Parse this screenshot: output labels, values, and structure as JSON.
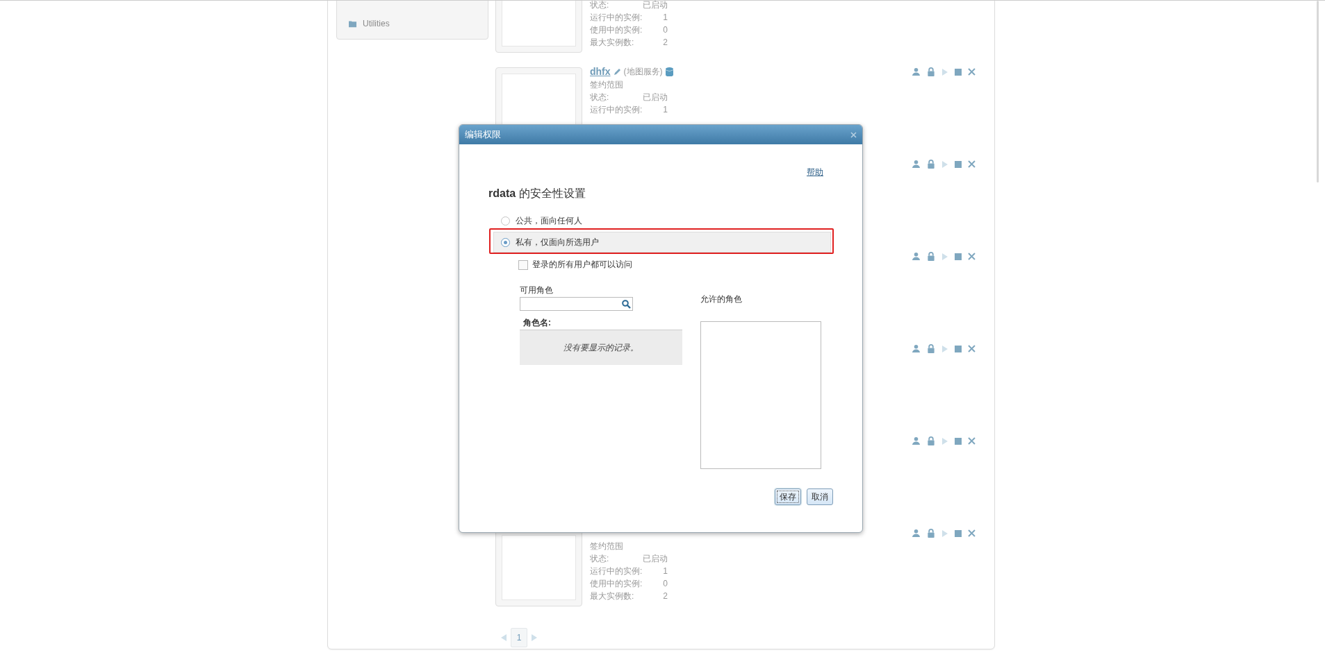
{
  "sidebar": {
    "items": [
      {
        "label": "Utilities"
      }
    ]
  },
  "services": [
    {
      "stats": [
        {
          "label": "状态:",
          "value": "已启动"
        },
        {
          "label": "运行中的实例:",
          "value": "1"
        },
        {
          "label": "使用中的实例:",
          "value": "0"
        },
        {
          "label": "最大实例数:",
          "value": "2"
        }
      ]
    },
    {
      "name": "dhfx",
      "type": "(地图服务)",
      "scope": "签约范围",
      "stats": [
        {
          "label": "状态:",
          "value": "已启动"
        },
        {
          "label": "运行中的实例:",
          "value": "1"
        }
      ],
      "running": true
    },
    {
      "running": true
    },
    {
      "running": true
    },
    {
      "running": true
    },
    {
      "running": true
    },
    {
      "scope": "签约范围",
      "stats": [
        {
          "label": "状态:",
          "value": "已启动"
        },
        {
          "label": "运行中的实例:",
          "value": "1"
        },
        {
          "label": "使用中的实例:",
          "value": "0"
        },
        {
          "label": "最大实例数:",
          "value": "2"
        }
      ],
      "running": true
    }
  ],
  "pagination": {
    "pages": [
      {
        "label": "1",
        "selected": true
      }
    ]
  },
  "dialog": {
    "title": "编辑权限",
    "help": "帮助",
    "heading": "**rdata** 的安全性设置",
    "options": [
      {
        "label": "公共，面向任何人",
        "selected": false,
        "highlighted": false
      },
      {
        "label": "私有，仅面向所选用户",
        "selected": true,
        "highlighted": true
      }
    ],
    "login_access": {
      "label": "登录的所有用户都可以访问",
      "checked": false
    },
    "available_roles": {
      "label": "可用角色",
      "column": "角色名:",
      "empty": "没有要显示的记录。"
    },
    "allowed_roles": {
      "label": "允许的角色"
    },
    "buttons": [
      {
        "label": "保存",
        "focused": true
      },
      {
        "label": "取消",
        "focused": false
      }
    ]
  }
}
